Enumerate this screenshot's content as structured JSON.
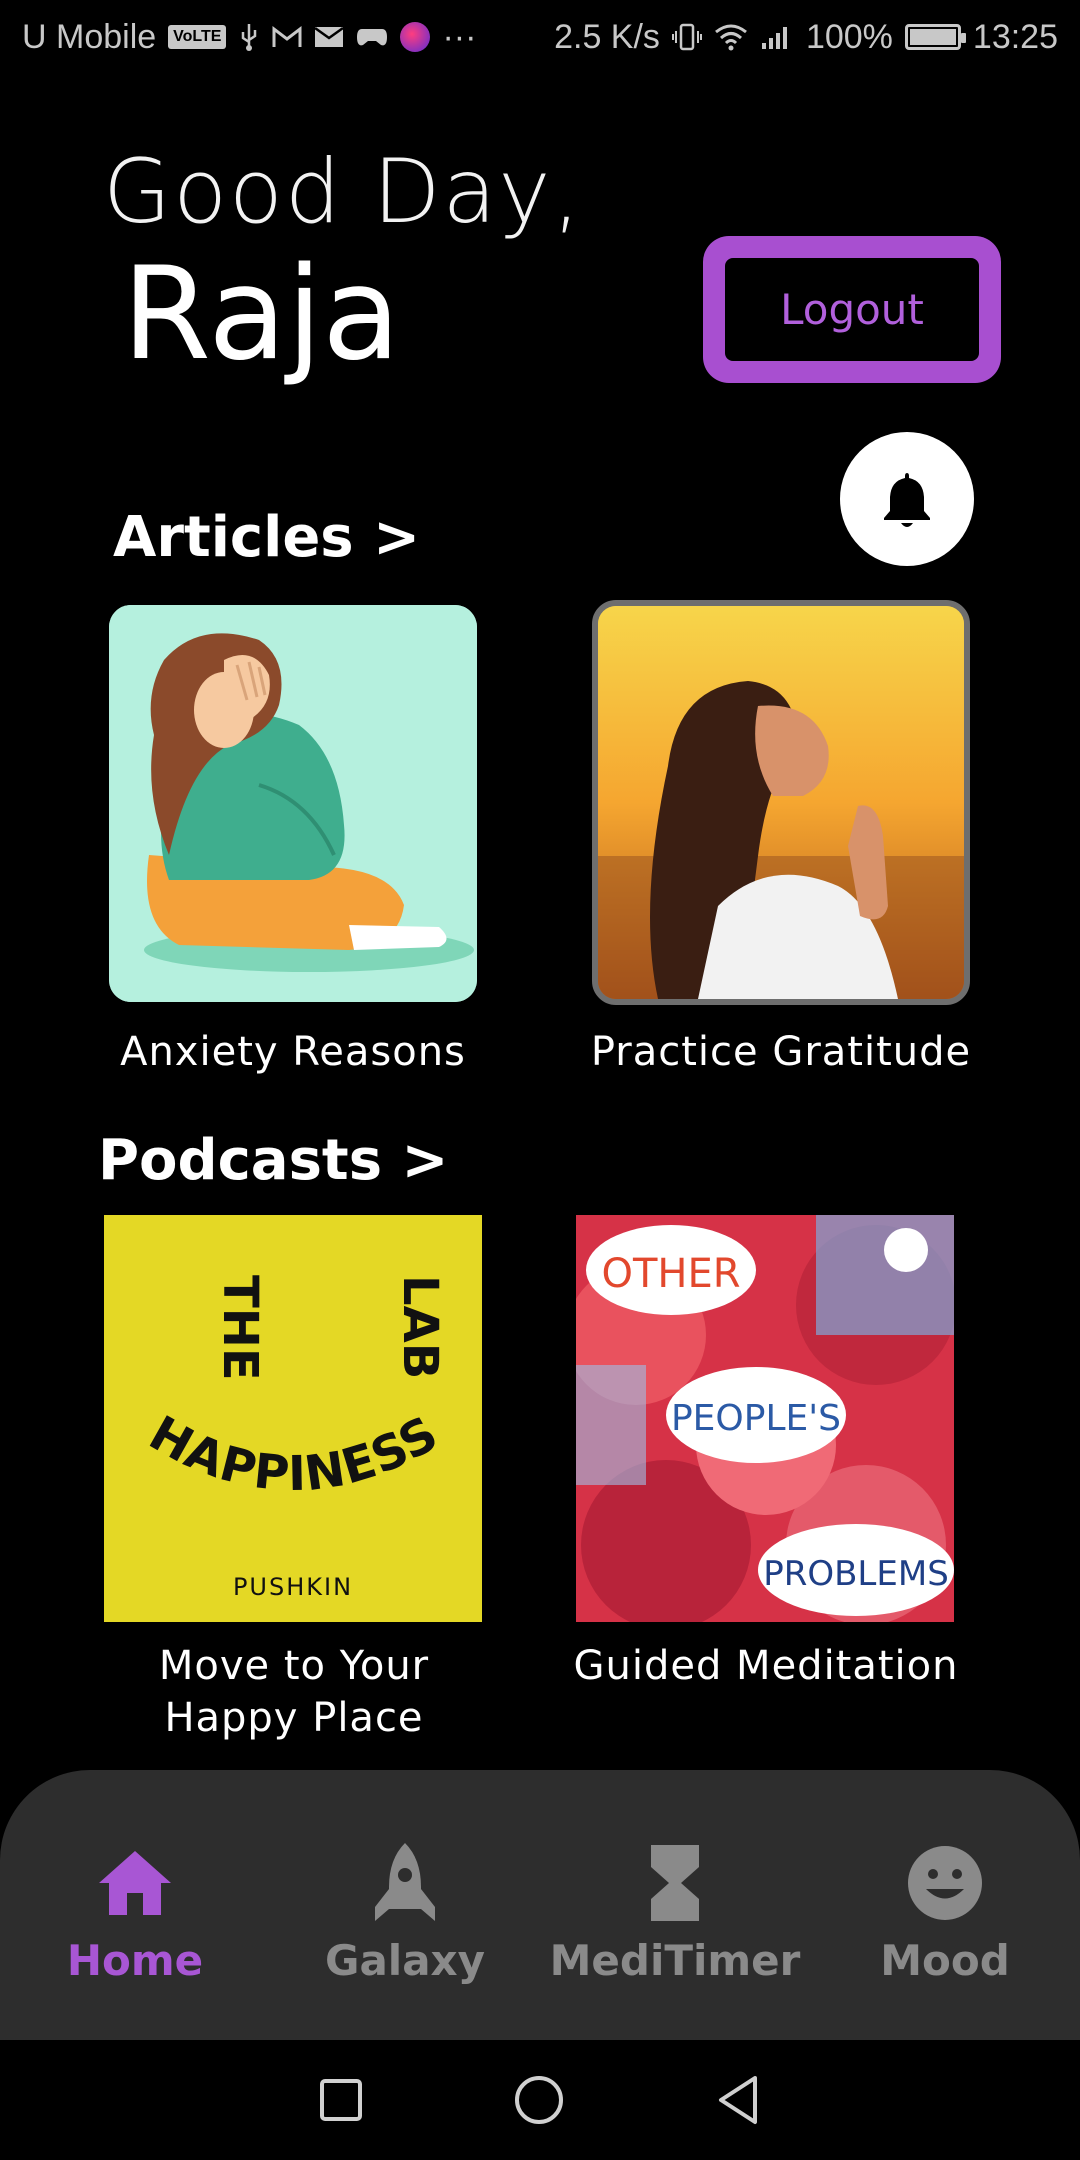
{
  "status_bar": {
    "carrier": "U Mobile",
    "volte": "VoLTE",
    "dots": "···",
    "speed": "2.5 K/s",
    "battery": "100%",
    "time": "13:25"
  },
  "header": {
    "greeting": "Good Day,",
    "user_name": "Raja",
    "logout_label": "Logout",
    "bell_icon": "bell-icon"
  },
  "articles": {
    "title": "Articles >",
    "items": [
      {
        "caption": "Anxiety Reasons"
      },
      {
        "caption": "Practice Gratitude"
      }
    ]
  },
  "podcasts": {
    "title": "Podcasts >",
    "items": [
      {
        "caption_line1": "Move to Your",
        "caption_line2": "Happy Place",
        "cover": {
          "line_the": "THE",
          "line_lab": "LAB",
          "line_happiness": "HAPPINESS",
          "publisher": "PUSHKIN"
        }
      },
      {
        "caption": "Guided Meditation",
        "cover": {
          "word1": "OTHER",
          "word2": "PEOPLE'S",
          "word3": "PROBLEMS"
        }
      }
    ]
  },
  "bottom_nav": {
    "items": [
      {
        "label": "Home",
        "icon": "home-icon",
        "active": true
      },
      {
        "label": "Galaxy",
        "icon": "rocket-icon",
        "active": false
      },
      {
        "label": "MediTimer",
        "icon": "hourglass-icon",
        "active": false
      },
      {
        "label": "Mood",
        "icon": "smiley-icon",
        "active": false
      }
    ]
  },
  "colors": {
    "background": "#000000",
    "accent": "#a856d4",
    "nav_background": "#2d2d2d",
    "nav_inactive": "#8a8a8a"
  }
}
